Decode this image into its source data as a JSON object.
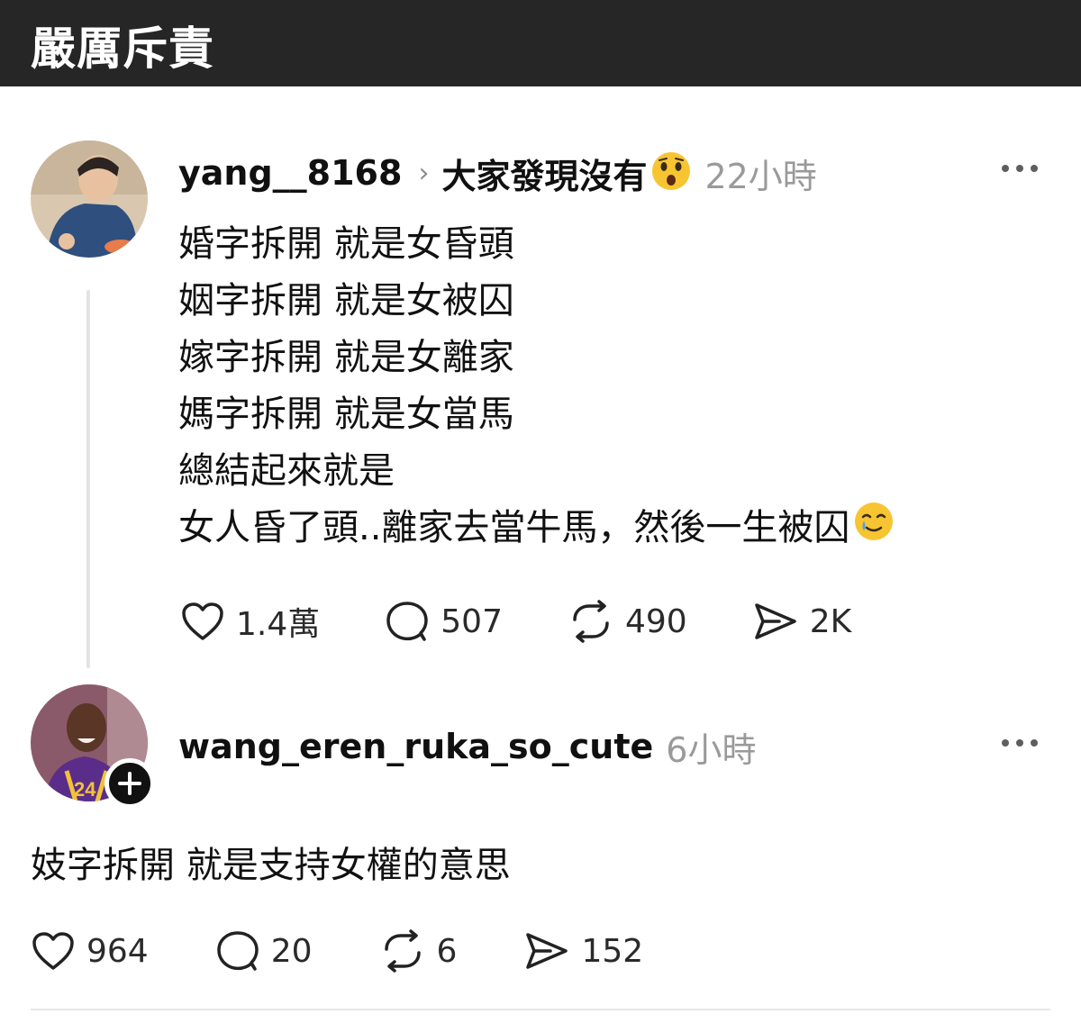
{
  "header": {
    "title": "嚴厲斥責"
  },
  "post": {
    "username": "yang__8168",
    "reply_target": "大家發現沒有",
    "reply_emoji": "astonished-face-emoji",
    "time": "22小時",
    "lines": [
      "婚字拆開 就是女昏頭",
      "姻字拆開 就是女被囚",
      "嫁字拆開 就是女離家",
      "媽字拆開 就是女當馬",
      "總結起來就是",
      "女人昏了頭..離家去當牛馬，然後一生被囚"
    ],
    "last_line_emoji": "smiling-face-with-tear-emoji",
    "stats": {
      "likes": "1.4萬",
      "comments": "507",
      "reposts": "490",
      "shares": "2K"
    }
  },
  "reply": {
    "username": "wang_eren_ruka_so_cute",
    "time": "6小時",
    "text": "妓字拆開 就是支持女權的意思",
    "stats": {
      "likes": "964",
      "comments": "20",
      "reposts": "6",
      "shares": "152"
    }
  },
  "colors": {
    "topbar": "#262626",
    "text": "#101010",
    "muted": "#9a9a9a",
    "emoji": "#f7c531"
  }
}
